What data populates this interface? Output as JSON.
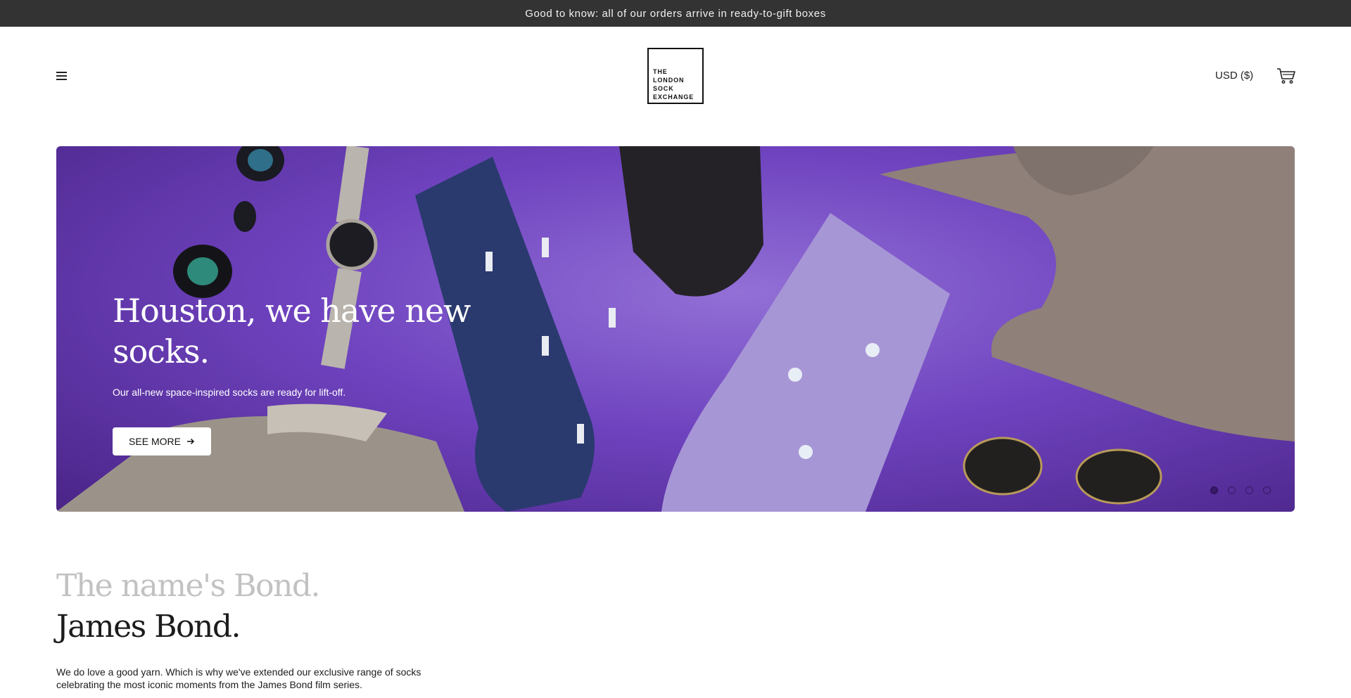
{
  "announcement": {
    "text": "Good to know: all of our orders arrive in ready-to-gift boxes"
  },
  "header": {
    "menu_icon": "hamburger-menu-icon",
    "logo_lines": [
      "THE",
      "LONDON",
      "SOCK",
      "EXCHANGE"
    ],
    "currency": "USD ($)",
    "cart_icon": "shopping-cart-icon"
  },
  "hero": {
    "title": "Houston, we have new socks.",
    "subtitle": "Our all-new space-inspired socks are ready for lift-off.",
    "button_label": "SEE MORE",
    "button_icon": "arrow-right-icon",
    "slide_count": 4,
    "active_slide": 1,
    "background_color": "#6f43bf"
  },
  "bond_section": {
    "title_line1": "The name's Bond.",
    "title_line2": "James Bond.",
    "body": "We do love a good yarn. Which is why we've extended our exclusive range of socks celebrating the most iconic moments from the James Bond film series."
  }
}
